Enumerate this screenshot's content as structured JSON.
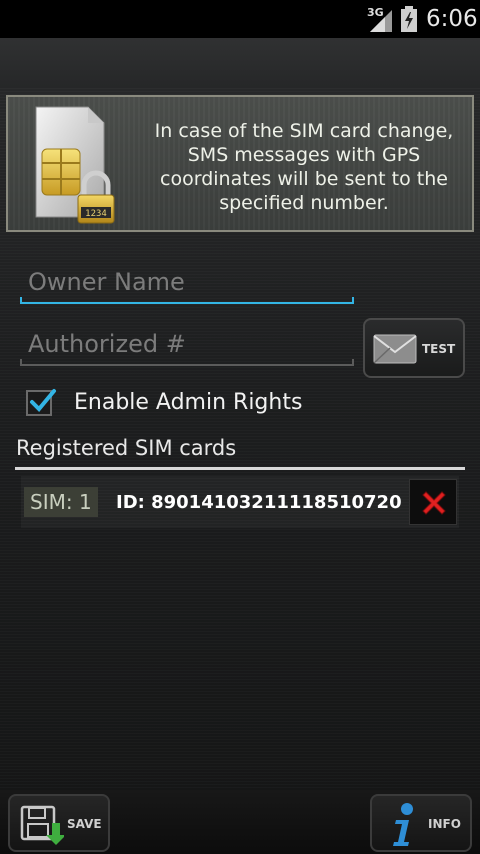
{
  "status_bar": {
    "network": "3G",
    "time": "6:06",
    "icons": [
      "signal-icon",
      "battery-icon"
    ]
  },
  "banner": {
    "icon": "sim-card-lock-icon",
    "lock_code": "1234",
    "text": "In case of the SIM card change, SMS messages with GPS coordinates will be sent to the specified number."
  },
  "form": {
    "owner_name": {
      "value": "",
      "placeholder": "Owner Name"
    },
    "authorized_number": {
      "value": "",
      "placeholder": "Authorized #"
    },
    "test_button": {
      "label": "TEST",
      "icon": "envelope-icon"
    },
    "admin_rights": {
      "label": "Enable Admin Rights",
      "checked": true
    }
  },
  "registered_sims": {
    "header": "Registered SIM cards",
    "items": [
      {
        "badge": "SIM: 1",
        "id_text": "ID: 89014103211118510720"
      }
    ]
  },
  "bottom_bar": {
    "save_label": "SAVE",
    "info_label": "INFO"
  },
  "colors": {
    "accent": "#33b5e5",
    "delete": "#e02020",
    "info_icon": "#2e8ed6",
    "save_arrow": "#3fae3f"
  }
}
